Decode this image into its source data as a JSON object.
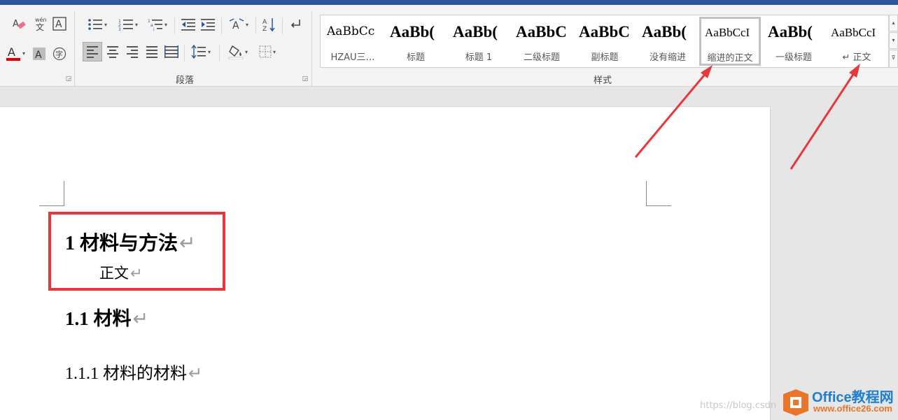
{
  "paragraph_group": {
    "label": "段落"
  },
  "styles_group": {
    "label": "样式",
    "styles": [
      {
        "preview": "AaBbCc",
        "name": "HZAU三…",
        "kind": "reg"
      },
      {
        "preview": "AaBb(",
        "name": "标题",
        "kind": "bold"
      },
      {
        "preview": "AaBb(",
        "name": "标题 1",
        "kind": "bold"
      },
      {
        "preview": "AaBbC",
        "name": "二级标题",
        "kind": "bold"
      },
      {
        "preview": "AaBbC",
        "name": "副标题",
        "kind": "bold"
      },
      {
        "preview": "AaBb(",
        "name": "没有缩进",
        "kind": "bold"
      },
      {
        "preview": "AaBbCcI",
        "name": "缩进的正文",
        "kind": "small",
        "selected": true
      },
      {
        "preview": "AaBb(",
        "name": "一级标题",
        "kind": "bold"
      },
      {
        "preview": "AaBbCcI",
        "name": "↵ 正文",
        "kind": "small"
      }
    ]
  },
  "document": {
    "heading1": "1  材料与方法",
    "body_text": "正文",
    "heading2": "1.1  材料",
    "heading3": "1.1.1  材料的材料",
    "paragraph_mark": "↵"
  },
  "watermark": "https://blog.csdn",
  "logo": {
    "title": "Office教程网",
    "url": "www.office26.com"
  },
  "colors": {
    "accent_blue": "#2b579a",
    "highlight_red": "#e8363d",
    "font_color_bar": "#e00000",
    "logo_orange": "#e9752a",
    "logo_blue": "#1f7fcf"
  },
  "icons": [
    "clear-formatting-icon",
    "phonetic-guide-icon",
    "character-border-icon",
    "font-color-icon",
    "character-shading-icon",
    "enclose-characters-icon",
    "bullets-icon",
    "numbering-icon",
    "multilevel-list-icon",
    "decrease-indent-icon",
    "increase-indent-icon",
    "text-direction-icon",
    "sort-icon",
    "paragraph-mark-icon",
    "align-left-icon",
    "center-icon",
    "align-right-icon",
    "justify-icon",
    "distributed-icon",
    "line-spacing-icon",
    "shading-icon",
    "borders-icon"
  ]
}
